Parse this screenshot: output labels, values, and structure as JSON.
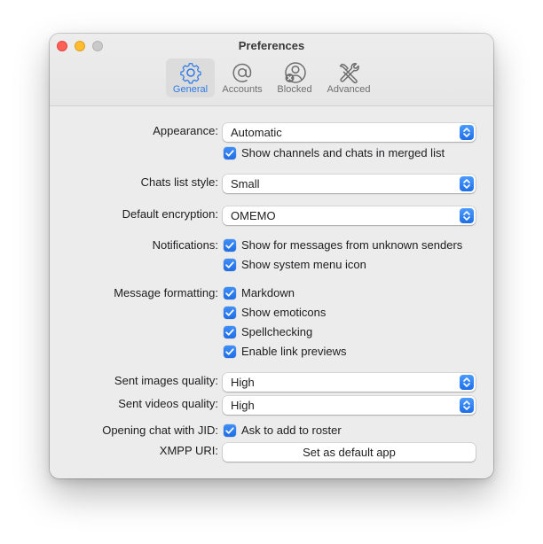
{
  "window": {
    "title": "Preferences"
  },
  "tabs": [
    {
      "label": "General",
      "icon": "gear-icon",
      "active": true
    },
    {
      "label": "Accounts",
      "icon": "at-sign-icon",
      "active": false
    },
    {
      "label": "Blocked",
      "icon": "blocked-user-icon",
      "active": false
    },
    {
      "label": "Advanced",
      "icon": "tools-icon",
      "active": false
    }
  ],
  "colors": {
    "accent": "#2f7ae5",
    "close": "#fe5f57",
    "minimize": "#febc2e",
    "window_bg": "#ececec"
  },
  "appearance": {
    "label": "Appearance:",
    "value": "Automatic",
    "merged_list": {
      "label": "Show channels and chats in merged list",
      "checked": true
    }
  },
  "chats_list_style": {
    "label": "Chats list style:",
    "value": "Small"
  },
  "default_encryption": {
    "label": "Default encryption:",
    "value": "OMEMO"
  },
  "notifications": {
    "label": "Notifications:",
    "options": [
      {
        "label": "Show for messages from unknown senders",
        "checked": true
      },
      {
        "label": "Show system menu icon",
        "checked": true
      }
    ]
  },
  "message_formatting": {
    "label": "Message formatting:",
    "options": [
      {
        "label": "Markdown",
        "checked": true
      },
      {
        "label": "Show emoticons",
        "checked": true
      },
      {
        "label": "Spellchecking",
        "checked": true
      },
      {
        "label": "Enable link previews",
        "checked": true
      }
    ]
  },
  "sent_images_quality": {
    "label": "Sent images quality:",
    "value": "High"
  },
  "sent_videos_quality": {
    "label": "Sent videos quality:",
    "value": "High"
  },
  "opening_chat": {
    "label": "Opening chat with JID:",
    "option": {
      "label": "Ask to add to roster",
      "checked": true
    }
  },
  "xmpp_uri": {
    "label": "XMPP URI:",
    "button": "Set as default app"
  }
}
